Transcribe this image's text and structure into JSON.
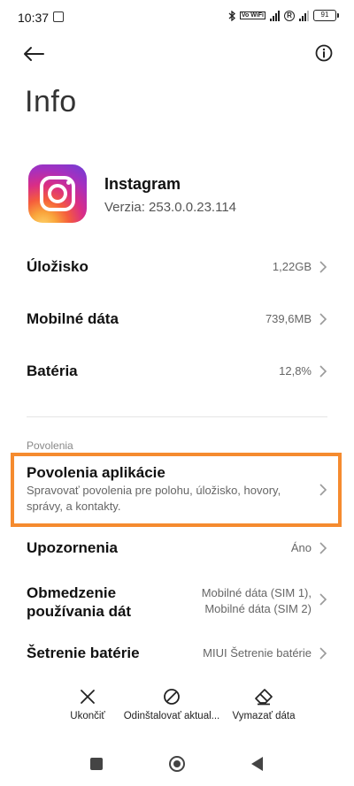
{
  "status_bar": {
    "time": "10:37",
    "volte": "Vo WiFi",
    "roaming": "R",
    "battery": "91"
  },
  "header": {
    "title": "Info"
  },
  "app": {
    "name": "Instagram",
    "version": "Verzia: 253.0.0.23.114"
  },
  "rows": {
    "storage": {
      "label": "Úložisko",
      "value": "1,22GB"
    },
    "mobile_data": {
      "label": "Mobilné dáta",
      "value": "739,6MB"
    },
    "battery": {
      "label": "Batéria",
      "value": "12,8%"
    }
  },
  "permissions_section": {
    "label": "Povolenia",
    "app_permissions": {
      "title": "Povolenia aplikácie",
      "description": "Spravovať povolenia pre polohu, úložisko, hovory, správy, a kontakty."
    },
    "highlight_color": "#f58b2f"
  },
  "notifications": {
    "label": "Upozornenia",
    "value": "Áno"
  },
  "data_usage": {
    "label": "Obmedzenie používania dát",
    "value_line1": "Mobilné dáta (SIM 1),",
    "value_line2": "Mobilné dáta (SIM 2)"
  },
  "battery_saver": {
    "label": "Šetrenie batérie",
    "value": "MIUI Šetrenie batérie"
  },
  "actions": {
    "force_stop": "Ukončiť",
    "uninstall_updates": "Odinštalovať aktual...",
    "clear_data": "Vymazať dáta"
  }
}
